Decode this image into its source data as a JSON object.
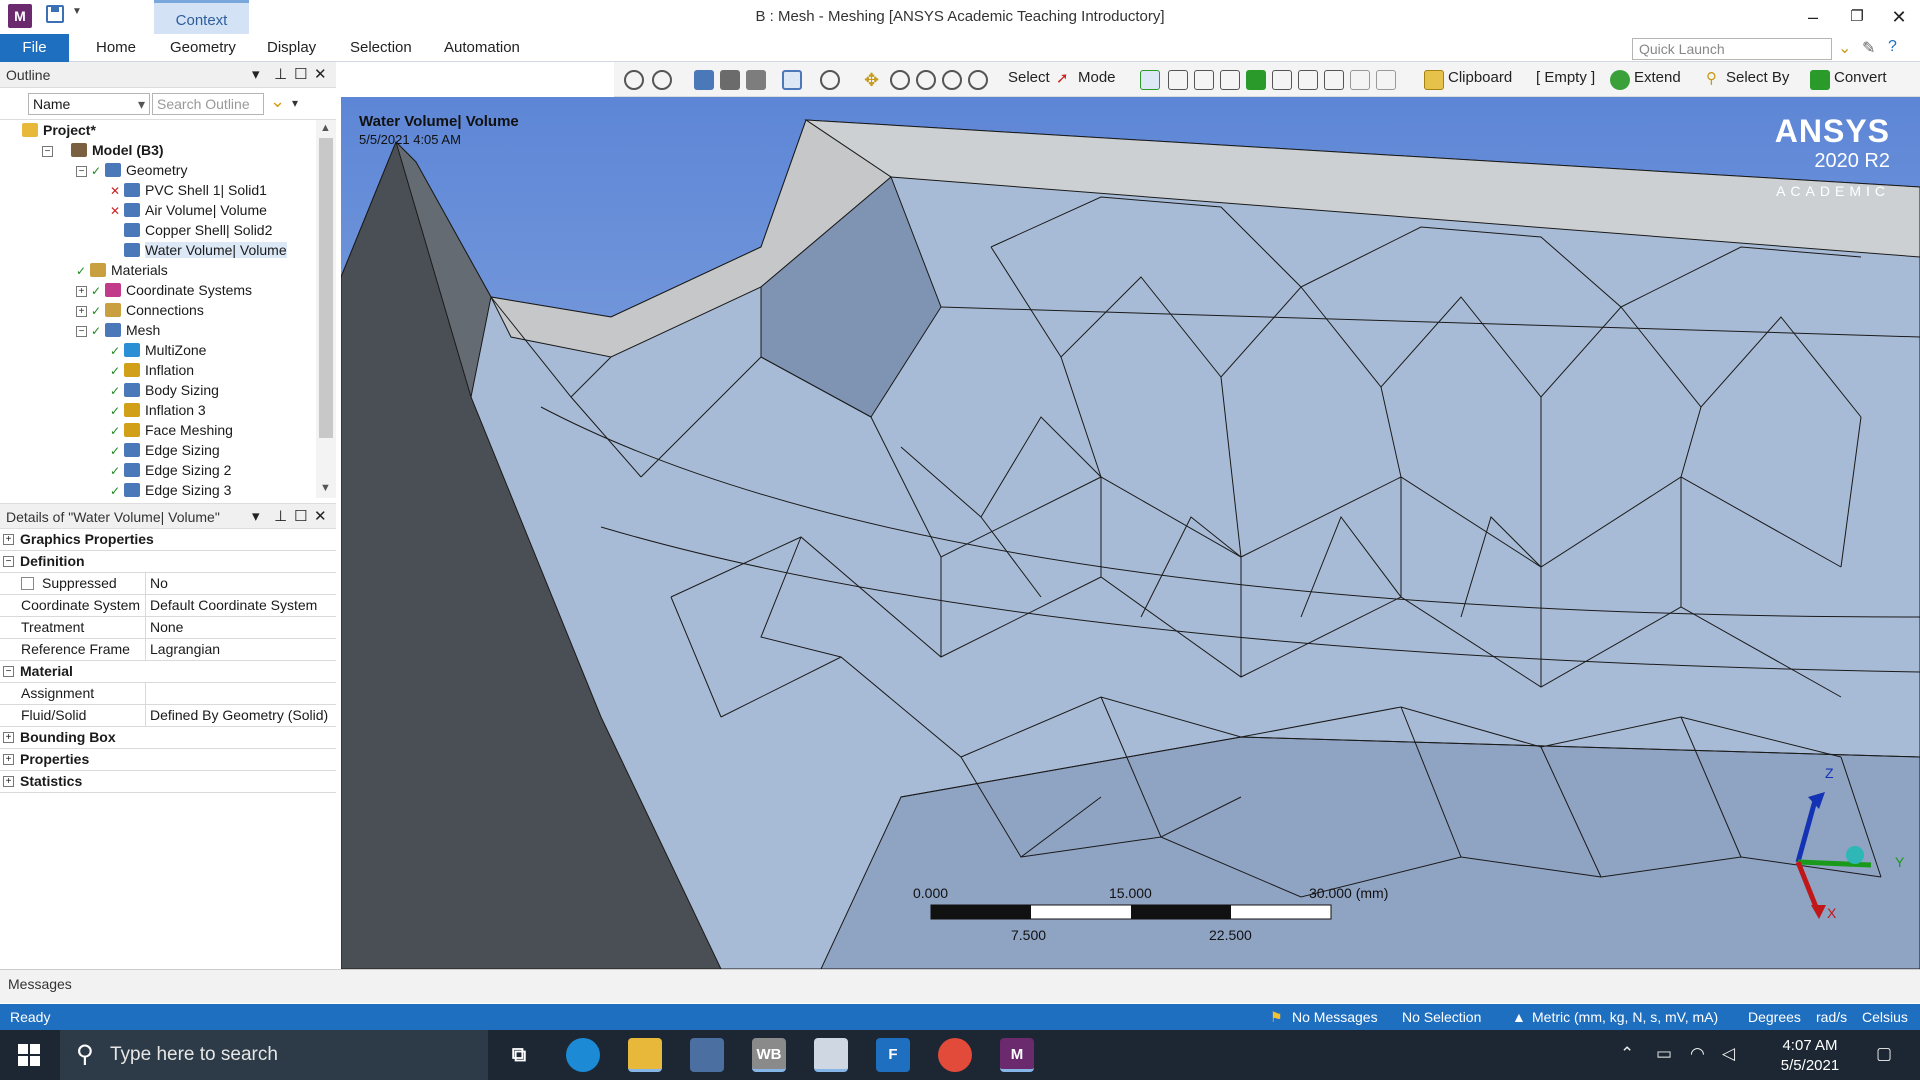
{
  "titlebar": {
    "app_icon": "M",
    "context_tab": "Context",
    "window_title": "B : Mesh - Meshing [ANSYS Academic Teaching Introductory]",
    "minimize": "–",
    "restore": "❐",
    "close": "✕"
  },
  "ribbon": {
    "file": "File",
    "tabs": [
      "Home",
      "Geometry",
      "Display",
      "Selection",
      "Automation"
    ],
    "quick_launch_placeholder": "Quick Launch"
  },
  "toolbar": {
    "select": "Select",
    "mode": "Mode",
    "clipboard": "Clipboard",
    "empty": "[ Empty ]",
    "extend": "Extend",
    "select_by": "Select By",
    "convert": "Convert"
  },
  "outline": {
    "title": "Outline",
    "filter_value": "Name",
    "search_placeholder": "Search Outline",
    "tree": [
      {
        "label": "Project*",
        "level": 0,
        "bold": true,
        "icon": "project-icon",
        "check": false,
        "exp": ""
      },
      {
        "label": "Model (B3)",
        "level": 1,
        "bold": true,
        "icon": "model-icon",
        "check": false,
        "exp": "−"
      },
      {
        "label": "Geometry",
        "level": 2,
        "bold": false,
        "icon": "geometry-icon",
        "check": true,
        "exp": "−"
      },
      {
        "label": "PVC Shell 1|  Solid1",
        "level": 3,
        "bold": false,
        "icon": "body-icon",
        "check": "x",
        "exp": ""
      },
      {
        "label": "Air Volume|  Volume",
        "level": 3,
        "bold": false,
        "icon": "body-icon",
        "check": "x",
        "exp": ""
      },
      {
        "label": "Copper Shell|  Solid2",
        "level": 3,
        "bold": false,
        "icon": "body-icon",
        "check": false,
        "exp": ""
      },
      {
        "label": "Water Volume|  Volume",
        "level": 3,
        "bold": false,
        "icon": "body-icon",
        "check": false,
        "exp": "",
        "selected": true
      },
      {
        "label": "Materials",
        "level": 2,
        "bold": false,
        "icon": "materials-icon",
        "check": true,
        "exp": ""
      },
      {
        "label": "Coordinate Systems",
        "level": 2,
        "bold": false,
        "icon": "coordinate-icon",
        "check": true,
        "exp": "+"
      },
      {
        "label": "Connections",
        "level": 2,
        "bold": false,
        "icon": "connections-icon",
        "check": true,
        "exp": "+"
      },
      {
        "label": "Mesh",
        "level": 2,
        "bold": false,
        "icon": "mesh-icon",
        "check": true,
        "exp": "−"
      },
      {
        "label": "MultiZone",
        "level": 3,
        "bold": false,
        "icon": "multizone-icon",
        "check": true,
        "exp": ""
      },
      {
        "label": "Inflation",
        "level": 3,
        "bold": false,
        "icon": "inflation-icon",
        "check": true,
        "exp": ""
      },
      {
        "label": "Body Sizing",
        "level": 3,
        "bold": false,
        "icon": "sizing-icon",
        "check": true,
        "exp": ""
      },
      {
        "label": "Inflation 3",
        "level": 3,
        "bold": false,
        "icon": "inflation-icon",
        "check": true,
        "exp": ""
      },
      {
        "label": "Face Meshing",
        "level": 3,
        "bold": false,
        "icon": "face-meshing-icon",
        "check": true,
        "exp": ""
      },
      {
        "label": "Edge Sizing",
        "level": 3,
        "bold": false,
        "icon": "sizing-icon",
        "check": true,
        "exp": ""
      },
      {
        "label": "Edge Sizing 2",
        "level": 3,
        "bold": false,
        "icon": "sizing-icon",
        "check": true,
        "exp": ""
      },
      {
        "label": "Edge Sizing 3",
        "level": 3,
        "bold": false,
        "icon": "sizing-icon",
        "check": true,
        "exp": ""
      }
    ]
  },
  "details": {
    "title": "Details of \"Water Volume|  Volume\"",
    "groups": {
      "graphics": "Graphics Properties",
      "definition": "Definition",
      "material": "Material",
      "bounding": "Bounding Box",
      "properties": "Properties",
      "statistics": "Statistics"
    },
    "rows": {
      "suppressed": {
        "name": "Suppressed",
        "value": "No"
      },
      "coord": {
        "name": "Coordinate System",
        "value": "Default Coordinate System"
      },
      "treatment": {
        "name": "Treatment",
        "value": "None"
      },
      "frame": {
        "name": "Reference Frame",
        "value": "Lagrangian"
      },
      "assignment": {
        "name": "Assignment",
        "value": ""
      },
      "fluid": {
        "name": "Fluid/Solid",
        "value": "Defined By Geometry (Solid)"
      }
    }
  },
  "viewport": {
    "label": "Water Volume|  Volume",
    "date": "5/5/2021 4:05 AM",
    "logo_name": "ANSYS",
    "logo_version": "2020 R2",
    "logo_edition": "ACADEMIC",
    "scale": {
      "t0": "0.000",
      "t15": "15.000",
      "t30": "30.000 (mm)",
      "t7": "7.500",
      "t22": "22.500"
    },
    "axes": {
      "z": "Z",
      "y": "Y",
      "x": "X"
    }
  },
  "messages": {
    "label": "Messages"
  },
  "status": {
    "ready": "Ready",
    "no_messages": "No Messages",
    "no_selection": "No Selection",
    "units": "Metric (mm, kg, N, s, mV, mA)",
    "degrees": "Degrees",
    "rads": "rad/s",
    "celsius": "Celsius"
  },
  "taskbar": {
    "search_placeholder": "Type here to search",
    "time": "4:07 AM",
    "date": "5/5/2021",
    "apps": [
      "task-view",
      "edge",
      "file-explorer",
      "store",
      "workbench",
      "mechanical-app",
      "fluent",
      "chrome",
      "meshing"
    ]
  },
  "colors": {
    "accent": "#1f6fc0",
    "viewport_bg": "#6a8ecc",
    "mesh_face": "#b7c7dd",
    "mesh_dark": "#4a4f56"
  }
}
